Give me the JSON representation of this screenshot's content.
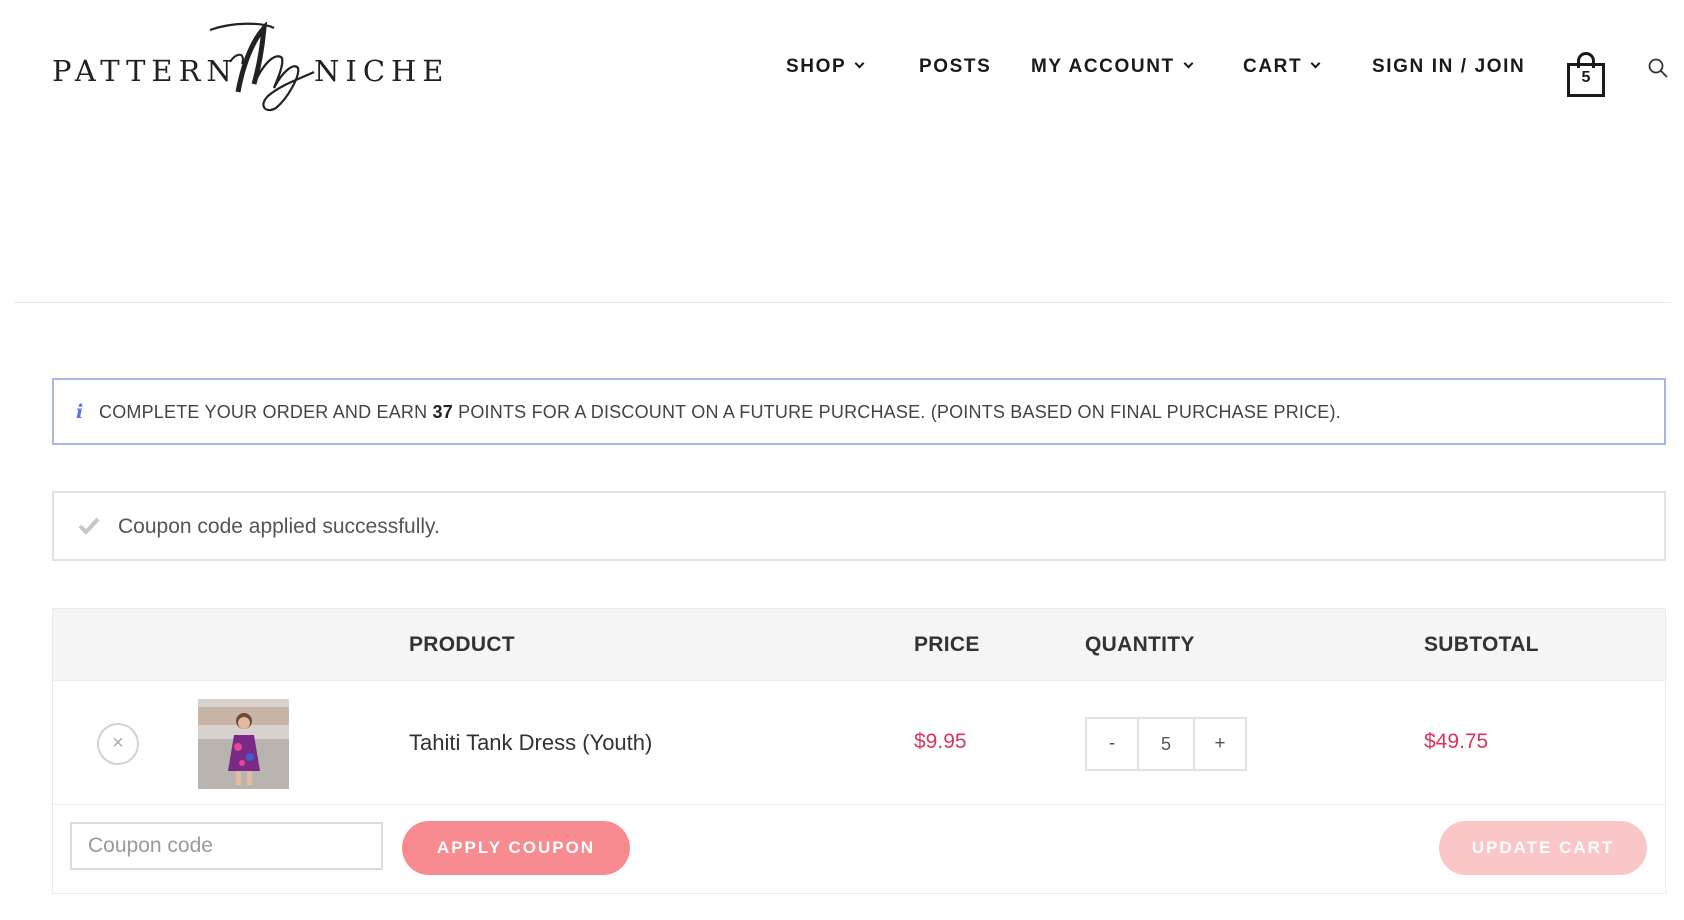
{
  "brand": {
    "word_left": "PATTERN",
    "word_right": "NICHE"
  },
  "nav": {
    "items": [
      {
        "label": "SHOP",
        "has_dropdown": true
      },
      {
        "label": "POSTS",
        "has_dropdown": false
      },
      {
        "label": "MY ACCOUNT",
        "has_dropdown": true
      },
      {
        "label": "CART",
        "has_dropdown": true
      },
      {
        "label": "SIGN IN / JOIN",
        "has_dropdown": false
      }
    ],
    "cart_count": "5",
    "search_icon": "search-icon"
  },
  "notices": {
    "points": {
      "icon": "info-icon",
      "before": "COMPLETE YOUR ORDER AND EARN ",
      "points": "37",
      "after": " POINTS FOR A DISCOUNT ON A FUTURE PURCHASE. (POINTS BASED ON FINAL PURCHASE PRICE)."
    },
    "coupon": {
      "icon": "check-icon",
      "text": "Coupon code applied successfully."
    }
  },
  "table": {
    "headers": {
      "product": "PRODUCT",
      "price": "PRICE",
      "quantity": "QUANTITY",
      "subtotal": "SUBTOTAL"
    },
    "rows": [
      {
        "remove_label": "×",
        "product_name": "Tahiti Tank Dress (Youth)",
        "price": "$9.95",
        "quantity": "5",
        "subtotal": "$49.75"
      }
    ],
    "qty_minus": "-",
    "qty_plus": "+"
  },
  "actions": {
    "coupon_placeholder": "Coupon code",
    "apply_label": "APPLY COUPON",
    "update_label": "UPDATE CART"
  },
  "colors": {
    "price_red": "#d9365e",
    "button_pink": "#f78b8f",
    "button_pink_disabled": "#fbc6c7",
    "info_border": "#a9b4f0"
  }
}
